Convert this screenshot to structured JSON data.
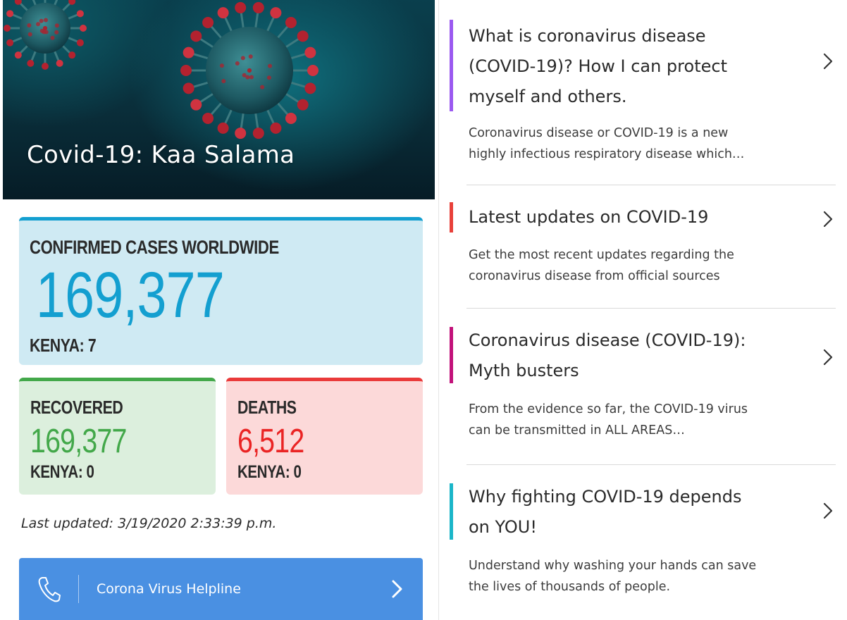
{
  "hero": {
    "title": "Covid-19: Kaa Salama"
  },
  "stats": {
    "confirmed": {
      "label": "CONFIRMED CASES WORLDWIDE",
      "value": "169,377",
      "kenya": "KENYA: 7",
      "color": "#139fd0"
    },
    "recovered": {
      "label": "RECOVERED",
      "value": "169,377",
      "kenya": "KENYA: 0",
      "color": "#43a84a"
    },
    "deaths": {
      "label": "DEATHS",
      "value": "6,512",
      "kenya": "KENYA: 0",
      "color": "#ea2424"
    }
  },
  "last_updated": "Last updated: 3/19/2020 2:33:39 p.m.",
  "helpline": {
    "label": "Corona Virus Helpline",
    "icon": "phone-icon",
    "color": "#4a90e2"
  },
  "articles": [
    {
      "title_lines": [
        "What is coronavirus disease",
        "(COVID-19)? How I can protect",
        "myself and others."
      ],
      "description_lines": [
        "Coronavirus disease or COVID-19 is a new",
        "highly infectious respiratory disease which…"
      ],
      "accent": "#9b59f0"
    },
    {
      "title_lines": [
        "Latest updates on COVID-19"
      ],
      "description_lines": [
        "Get the most recent updates regarding the",
        "coronavirus disease from official sources"
      ],
      "accent": "#e8413a"
    },
    {
      "title_lines": [
        "Coronavirus disease (COVID-19):",
        "Myth busters"
      ],
      "description_lines": [
        "From the evidence so far, the COVID-19 virus",
        "can be transmitted in ALL AREAS…"
      ],
      "accent": "#c2127a"
    },
    {
      "title_lines": [
        "Why fighting COVID-19 depends",
        "on YOU!"
      ],
      "description_lines": [
        "Understand why washing your hands can save",
        "the lives of thousands of people."
      ],
      "accent": "#1bb6c9"
    }
  ]
}
